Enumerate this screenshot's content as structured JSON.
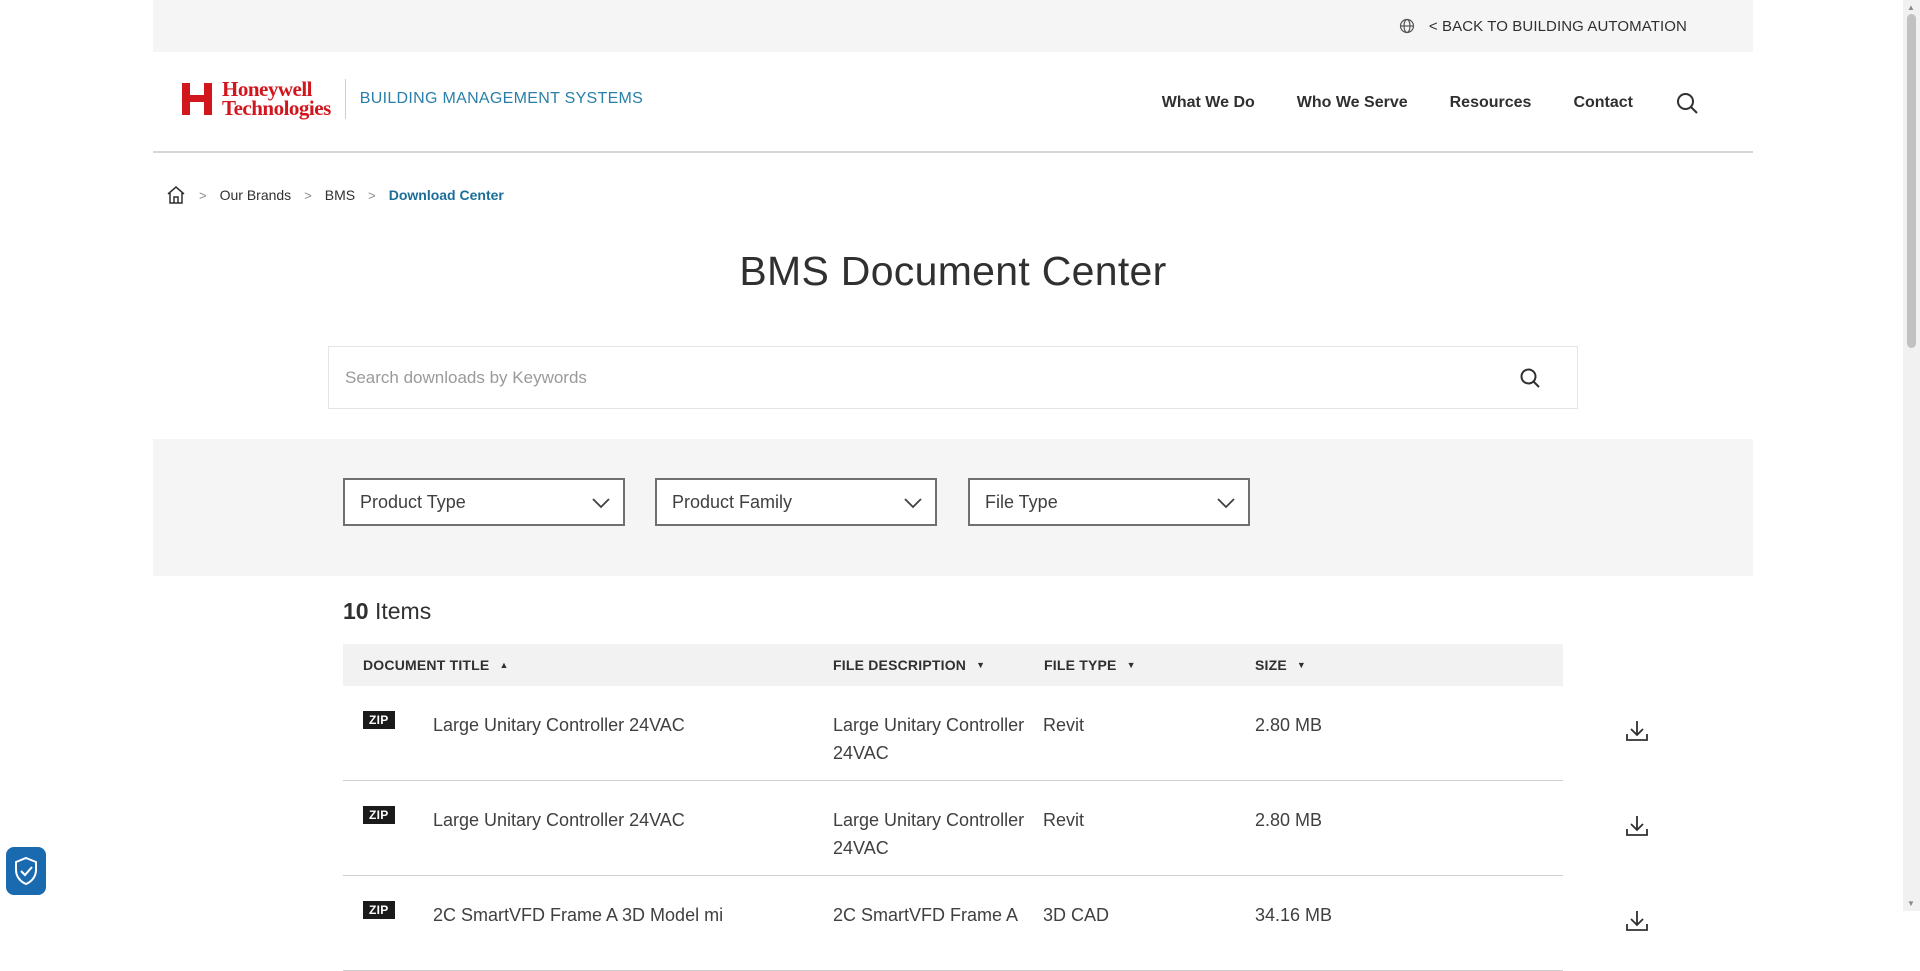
{
  "utility": {
    "back_label": "< BACK TO BUILDING AUTOMATION"
  },
  "header": {
    "logo_line1": "Honeywell",
    "logo_line2": "Technologies",
    "logo_sub": "BUILDING MANAGEMENT SYSTEMS",
    "nav": [
      {
        "label": "What We Do"
      },
      {
        "label": "Who We Serve"
      },
      {
        "label": "Resources"
      },
      {
        "label": "Contact"
      }
    ]
  },
  "breadcrumb": {
    "items": [
      "Our Brands",
      "BMS"
    ],
    "current": "Download Center",
    "separator": ">"
  },
  "page": {
    "title": "BMS Document Center"
  },
  "search": {
    "placeholder": "Search downloads by Keywords",
    "value": ""
  },
  "filters": [
    {
      "label": "Product Type"
    },
    {
      "label": "Product Family"
    },
    {
      "label": "File Type"
    }
  ],
  "results": {
    "count": "10",
    "count_label": "Items"
  },
  "table": {
    "headers": [
      {
        "label": "DOCUMENT TITLE",
        "sort": "▲"
      },
      {
        "label": "FILE DESCRIPTION",
        "sort": "▼"
      },
      {
        "label": "FILE TYPE",
        "sort": "▼"
      },
      {
        "label": "SIZE",
        "sort": "▼"
      }
    ],
    "rows": [
      {
        "badge": "ZIP",
        "title": "Large Unitary Controller 24VAC",
        "description": "Large Unitary Controller 24VAC",
        "file_type": "Revit",
        "size": "2.80 MB"
      },
      {
        "badge": "ZIP",
        "title": "Large Unitary Controller 24VAC",
        "description": "Large Unitary Controller 24VAC",
        "file_type": "Revit",
        "size": "2.80 MB"
      },
      {
        "badge": "ZIP",
        "title": "2C SmartVFD Frame A 3D Model mi",
        "description": "2C SmartVFD Frame A",
        "file_type": "3D CAD",
        "size": "34.16 MB"
      }
    ]
  },
  "colors": {
    "brand_red": "#d2161e",
    "link_blue": "#1a6e99",
    "filter_bg": "#f5f5f5"
  }
}
